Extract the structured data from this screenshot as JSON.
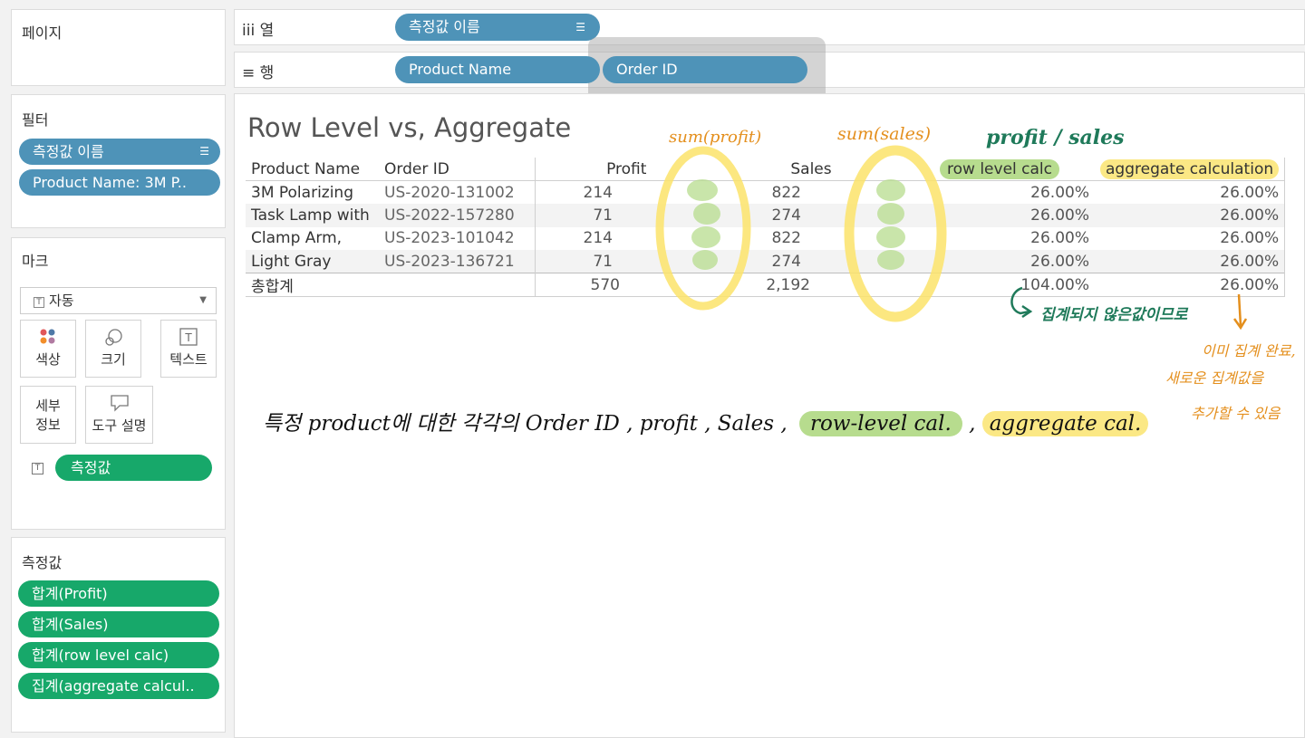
{
  "left": {
    "pages": {
      "title": "페이지"
    },
    "filters": {
      "title": "필터",
      "items": [
        "측정값 이름",
        "Product Name: 3M P.."
      ]
    },
    "marks": {
      "title": "마크",
      "type": "자동",
      "buttons": {
        "color": "색상",
        "size": "크기",
        "text": "텍스트",
        "detail_1": "세부",
        "detail_2": "정보",
        "tooltip": "도구 설명"
      },
      "measure_pill": "측정값"
    },
    "measures": {
      "title": "측정값",
      "items": [
        "합계(Profit)",
        "합계(Sales)",
        "합계(row level calc)",
        "집계(aggregate calcul.."
      ]
    }
  },
  "shelves": {
    "columns": {
      "label": "열",
      "icon": "iii",
      "pills": [
        "측정값 이름"
      ]
    },
    "rows": {
      "label": "행",
      "icon": "≡",
      "pills": [
        "Product Name",
        "Order ID"
      ]
    }
  },
  "viz": {
    "title": "Row Level vs, Aggregate",
    "headers": [
      "Product Name",
      "Order ID",
      "Profit",
      "Sales",
      "row level calc",
      "aggregate calculation"
    ],
    "rows": [
      {
        "product": "3M Polarizing",
        "order": "US-2020-131002",
        "profit": "214",
        "sales": "822",
        "rlc": "26.00%",
        "agg": "26.00%"
      },
      {
        "product": "Task Lamp with",
        "order": "US-2022-157280",
        "profit": "71",
        "sales": "274",
        "rlc": "26.00%",
        "agg": "26.00%"
      },
      {
        "product": "Clamp Arm,",
        "order": "US-2023-101042",
        "profit": "214",
        "sales": "822",
        "rlc": "26.00%",
        "agg": "26.00%"
      },
      {
        "product": "Light Gray",
        "order": "US-2023-136721",
        "profit": "71",
        "sales": "274",
        "rlc": "26.00%",
        "agg": "26.00%"
      }
    ],
    "total": {
      "label": "총합계",
      "profit": "570",
      "sales": "2,192",
      "rlc": "104.00%",
      "agg": "26.00%"
    }
  },
  "annotations": {
    "sum_profit": "sum(profit)",
    "sum_sales": "sum(sales)",
    "profit_sales": "profit / sales",
    "not_aggregated": "집계되지 않은값이므로",
    "already_1": "이미 집계 완료,",
    "already_2": "새로운 집계값을",
    "already_3": "추가할 수 있음",
    "bottom_line": {
      "prefix": "특정 product에 대한 각각의 Order ID , profit , Sales ,",
      "rlc": "row-level cal.",
      "sep": ",",
      "agg": "aggregate cal."
    }
  },
  "colors": {
    "blue_pill": "#4e93b8",
    "green_pill": "#17a86a",
    "highlight_green": "#b7dc8e",
    "highlight_yellow": "#fbe885",
    "annotation_orange": "#e48f1d",
    "annotation_teal": "#1f7a5a"
  }
}
